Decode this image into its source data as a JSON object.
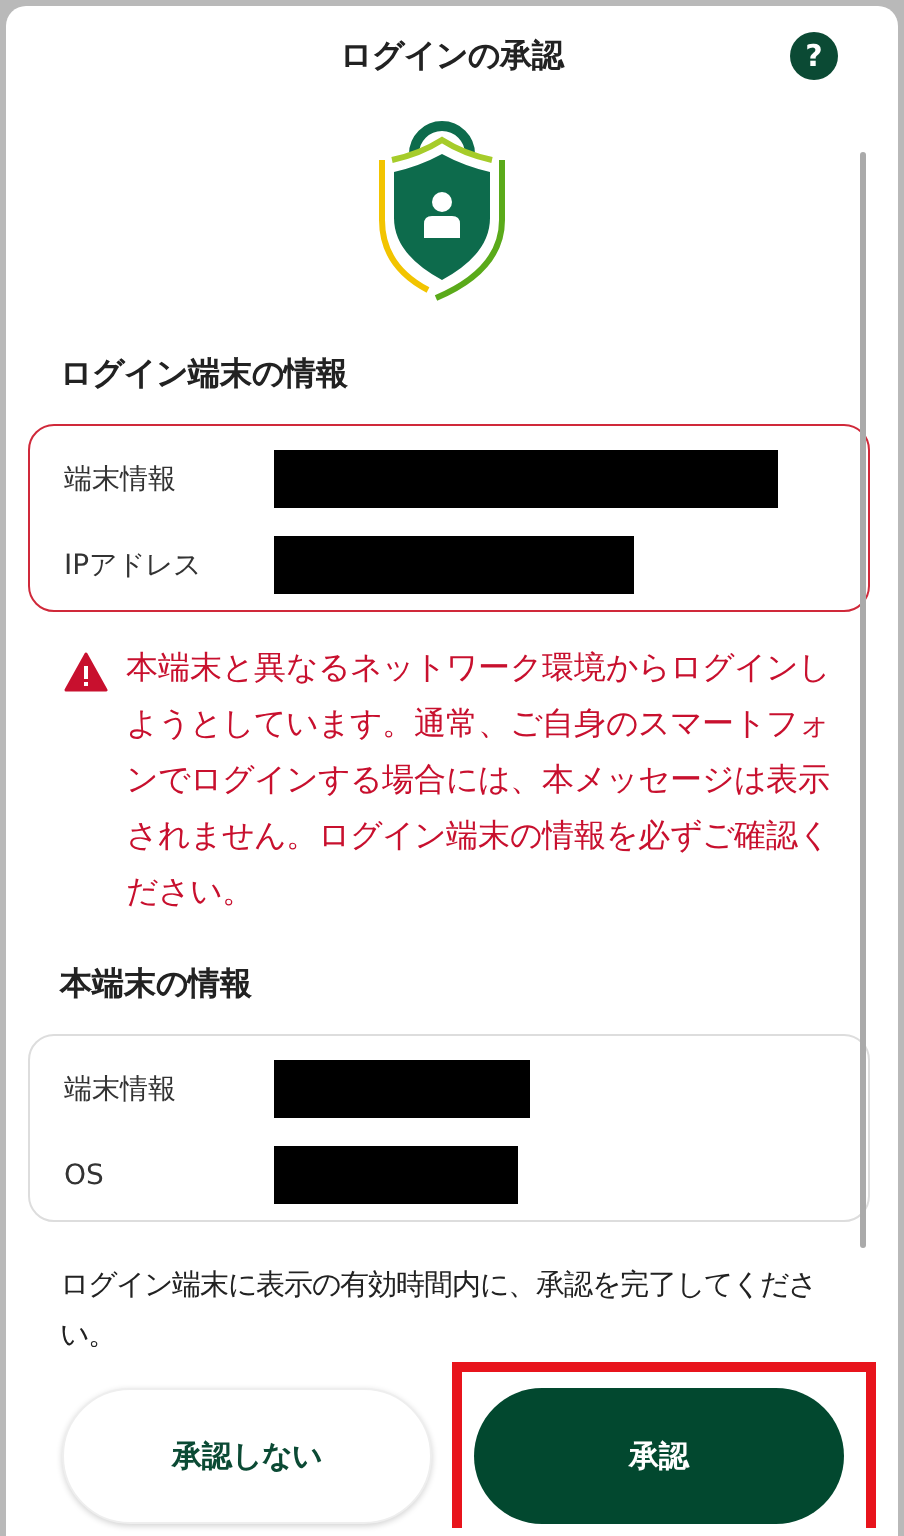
{
  "header": {
    "title": "ログインの承認",
    "help": "?"
  },
  "login_device": {
    "title": "ログイン端末の情報",
    "warning": true,
    "rows": [
      {
        "label": "端末情報",
        "redacted": true
      },
      {
        "label": "IPアドレス",
        "redacted": true
      }
    ],
    "alert": "本端末と異なるネットワーク環境からログインしようとしています。通常、ご自身のスマートフォンでログインする場合には、本メッセージは表示されません。ログイン端末の情報を必ずご確認ください。"
  },
  "this_device": {
    "title": "本端末の情報",
    "warning": false,
    "rows": [
      {
        "label": "端末情報",
        "redacted": true
      },
      {
        "label": "OS",
        "redacted": true
      }
    ]
  },
  "note": "ログイン端末に表示の有効時間内に、承認を完了してください。",
  "buttons": [
    {
      "label": "承認しない",
      "kind": "secondary",
      "highlighted": false
    },
    {
      "label": "承認",
      "kind": "primary",
      "highlighted": true
    }
  ]
}
